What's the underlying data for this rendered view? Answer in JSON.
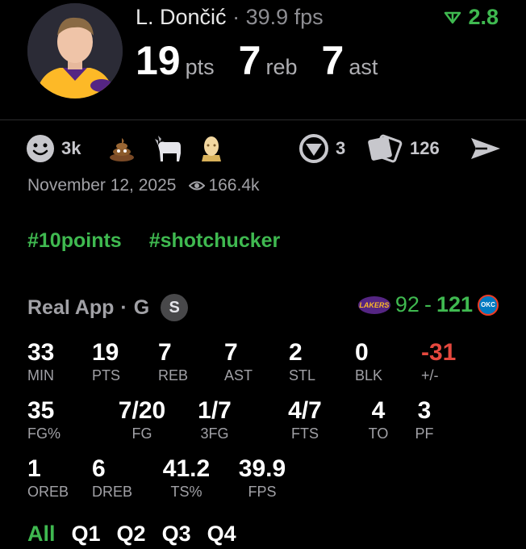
{
  "player": {
    "name": "L. Dončić",
    "separator": "·",
    "fps": "39.9 fps",
    "delta": "2.8"
  },
  "headline": [
    {
      "value": "19",
      "unit": "pts"
    },
    {
      "value": "7",
      "unit": "reb"
    },
    {
      "value": "7",
      "unit": "ast"
    }
  ],
  "reactions": {
    "smile_count": "3k",
    "comments_count": "3",
    "cards_count": "126"
  },
  "post_meta": {
    "date": "November 12, 2025",
    "views": "166.4k"
  },
  "hashtags": [
    "#10points",
    "#shotchucker"
  ],
  "game": {
    "source": "Real App",
    "separator": "·",
    "position": "G",
    "badge": "S",
    "home_logo_text": "LAKERS",
    "away_logo_text": "OKC",
    "home_score": "92",
    "dash": "-",
    "away_score": "121"
  },
  "stats_row1": [
    {
      "value": "33",
      "label": "MIN"
    },
    {
      "value": "19",
      "label": "PTS"
    },
    {
      "value": "7",
      "label": "REB"
    },
    {
      "value": "7",
      "label": "AST"
    },
    {
      "value": "2",
      "label": "STL"
    },
    {
      "value": "0",
      "label": "BLK"
    },
    {
      "value": "-31",
      "label": "+/-"
    }
  ],
  "stats_row2": [
    {
      "value": "35",
      "label": "FG%"
    },
    {
      "value": "7/20",
      "label": "FG"
    },
    {
      "value": "1/7",
      "label": "3FG"
    },
    {
      "value": "4/7",
      "label": "FTS"
    },
    {
      "value": "4",
      "label": "TO"
    },
    {
      "value": "3",
      "label": "PF"
    }
  ],
  "stats_row3": [
    {
      "value": "1",
      "label": "OREB"
    },
    {
      "value": "6",
      "label": "DREB"
    },
    {
      "value": "41.2",
      "label": "TS%"
    },
    {
      "value": "39.9",
      "label": "FPS"
    }
  ],
  "quarter_tabs": [
    "All",
    "Q1",
    "Q2",
    "Q3",
    "Q4"
  ],
  "colors": {
    "accent_green": "#3fb950",
    "negative_red": "#e5483e",
    "background": "#000000"
  }
}
